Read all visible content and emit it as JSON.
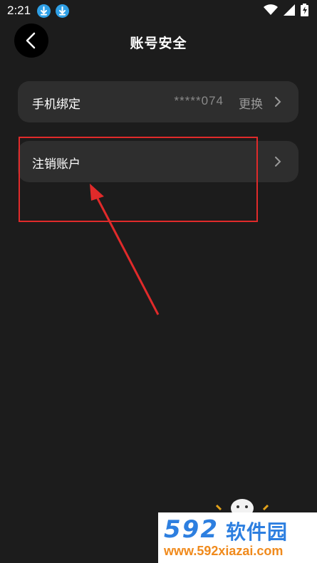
{
  "status_bar": {
    "time": "2:21",
    "icons": [
      "download-icon",
      "download-icon",
      "wifi-icon",
      "signal-icon",
      "battery-charging-icon"
    ]
  },
  "header": {
    "back_icon": "chevron-left-icon",
    "title": "账号安全"
  },
  "rows": [
    {
      "label": "手机绑定",
      "masked_phone": "*****074",
      "action": "更换",
      "icon": "chevron-right-icon"
    },
    {
      "label": "注销账户",
      "icon": "chevron-right-icon"
    }
  ],
  "annotation": {
    "color": "#e02a2a",
    "shapes": [
      "highlight-box",
      "pointer-arrow"
    ]
  },
  "watermark": {
    "number": "592",
    "brand": "软件园",
    "url": "www.592xiazai.com",
    "colors": {
      "blue": "#2d7fe0",
      "orange": "#f08a1c"
    }
  },
  "colors": {
    "background": "#1c1c1c",
    "row": "#2e2e2e",
    "muted_text": "#9a9a9a"
  }
}
